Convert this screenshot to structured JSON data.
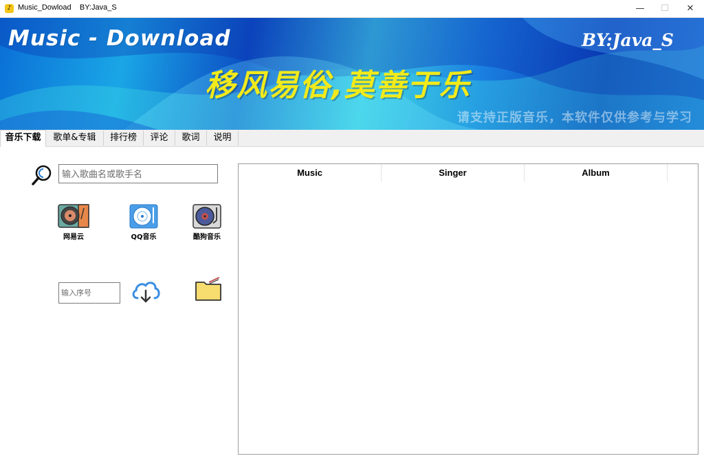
{
  "window": {
    "title": "Music_Dowload    BY:Java_S",
    "minimize": "—",
    "maximize": "☐",
    "close": "✕"
  },
  "banner": {
    "title": "Music - Download",
    "author": "BY:Java_S",
    "slogan": "移风易俗,莫善于乐",
    "notice": "请支持正版音乐，本软件仅供参考与学习"
  },
  "tabs": [
    {
      "label": "音乐下载",
      "active": true
    },
    {
      "label": "歌单&专辑",
      "active": false
    },
    {
      "label": "排行榜",
      "active": false
    },
    {
      "label": "评论",
      "active": false
    },
    {
      "label": "歌词",
      "active": false
    },
    {
      "label": "说明",
      "active": false
    }
  ],
  "search": {
    "placeholder": "输入歌曲名或歌手名",
    "value": ""
  },
  "sources": [
    {
      "label": "网易云",
      "icon": "netease-record-icon"
    },
    {
      "label": "QQ音乐",
      "icon": "qq-cd-icon"
    },
    {
      "label": "酷狗音乐",
      "icon": "kugou-turntable-icon"
    }
  ],
  "download": {
    "index_placeholder": "输入序号",
    "index_value": ""
  },
  "table": {
    "columns": [
      "Music",
      "Singer",
      "Album"
    ],
    "rows": []
  },
  "colors": {
    "slogan": "#f2ea1a",
    "banner_base": "#0c4fc4",
    "accent_cyan": "#3ec9e6"
  }
}
